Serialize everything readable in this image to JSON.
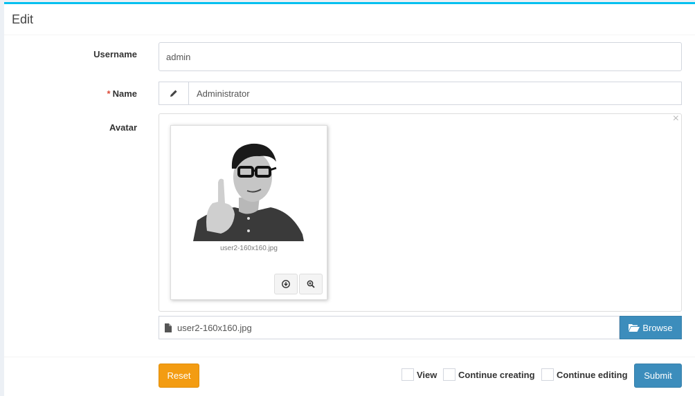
{
  "header": {
    "title": "Edit"
  },
  "form": {
    "username": {
      "label": "Username",
      "value": "admin"
    },
    "name": {
      "required_mark": "*",
      "label": "Name",
      "value": "Administrator",
      "icon": "pencil-icon"
    },
    "avatar": {
      "label": "Avatar",
      "close_glyph": "×",
      "thumbnail_caption": "user2-160x160.jpg",
      "file_caption": "user2-160x160.jpg",
      "browse_label": "Browse",
      "icons": [
        "download-icon",
        "zoom-icon",
        "file-icon",
        "folder-open-icon"
      ]
    }
  },
  "footer": {
    "reset_label": "Reset",
    "options": [
      {
        "label": "View",
        "checked": false
      },
      {
        "label": "Continue creating",
        "checked": false
      },
      {
        "label": "Continue editing",
        "checked": false
      }
    ],
    "submit_label": "Submit"
  },
  "colors": {
    "accent": "#00c0ef",
    "primary": "#3c8dbc",
    "warning": "#f39c12",
    "required": "#dd4b39"
  }
}
